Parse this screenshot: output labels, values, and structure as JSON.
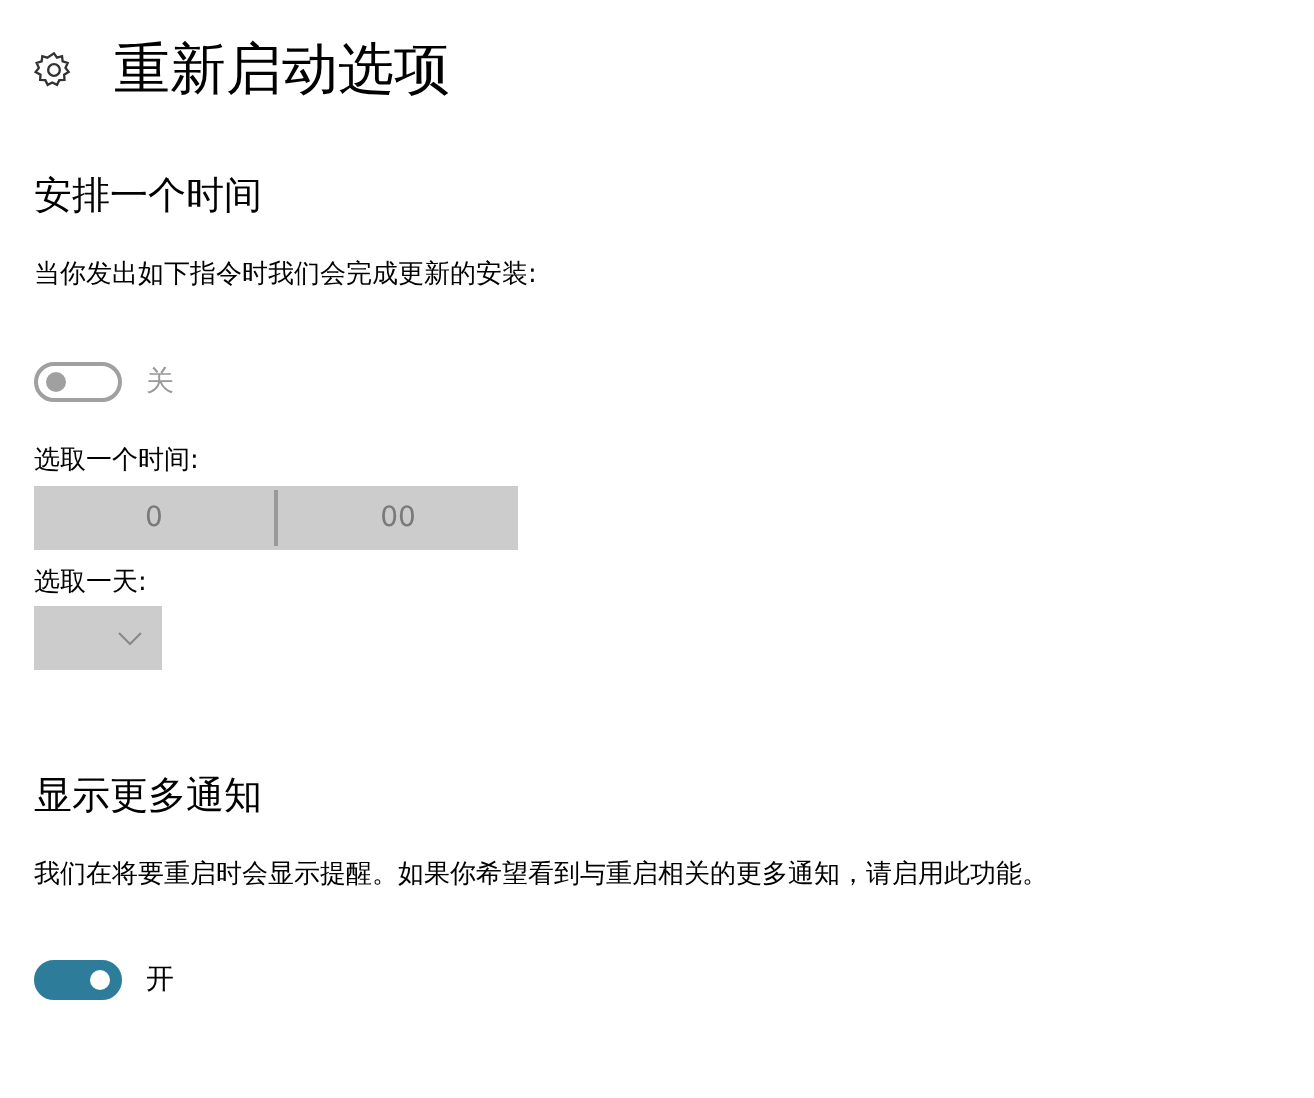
{
  "page": {
    "title": "重新启动选项"
  },
  "schedule": {
    "heading": "安排一个时间",
    "description": "当你发出如下指令时我们会完成更新的安装:",
    "toggle": {
      "on": false,
      "disabled": true,
      "label": "关"
    },
    "time_label": "选取一个时间:",
    "time": {
      "hour": "0",
      "minute": "00",
      "disabled": true
    },
    "day_label": "选取一天:",
    "day": {
      "disabled": true
    }
  },
  "notifications": {
    "heading": "显示更多通知",
    "description": "我们在将要重启时会显示提醒。如果你希望看到与重启相关的更多通知，请启用此功能。",
    "toggle": {
      "on": true,
      "disabled": false,
      "label": "开"
    }
  }
}
